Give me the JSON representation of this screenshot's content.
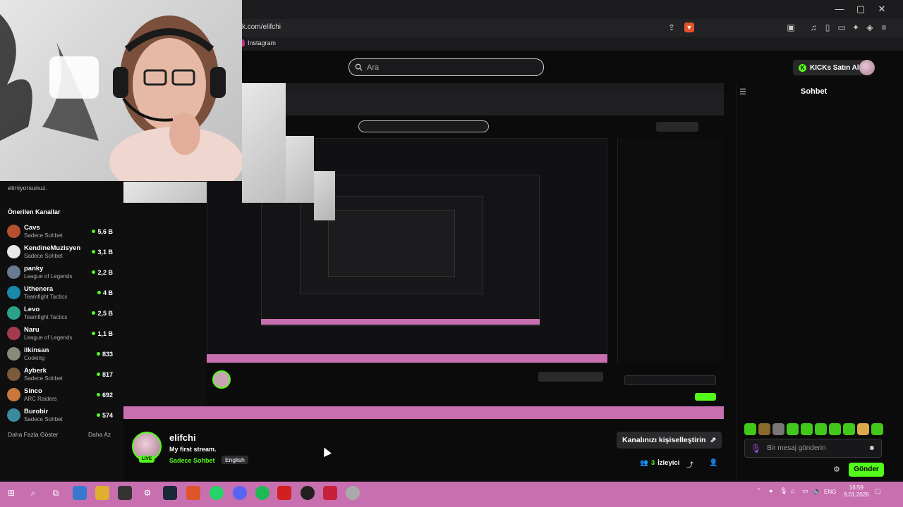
{
  "browser": {
    "url": "k.com/elifchi",
    "bookmark": "Instagram",
    "window_controls": [
      "—",
      "▢",
      "✕"
    ]
  },
  "header": {
    "search_placeholder": "Ara",
    "kicks_button": "KICKs Satın Al"
  },
  "sidebar": {
    "notice": "etmiyorsunuz.",
    "heading": "Önerilen Kanallar",
    "channels": [
      {
        "name": "Cavs",
        "category": "Sadece Sohbet",
        "viewers": "5,6 B",
        "color": "#b5502f"
      },
      {
        "name": "KendineMuzisyen",
        "category": "Sadece Sohbet",
        "viewers": "3,1 B",
        "color": "#e9e9e9"
      },
      {
        "name": "panky",
        "category": "League of Legends",
        "viewers": "2,2 B",
        "color": "#6a7a90"
      },
      {
        "name": "Uthenera",
        "category": "Teamfight Tactics",
        "viewers": "4 B",
        "color": "#1b88a8"
      },
      {
        "name": "Levo",
        "category": "Teamfight Tactics",
        "viewers": "2,5 B",
        "color": "#2aa38a"
      },
      {
        "name": "Naru",
        "category": "League of Legends",
        "viewers": "1,1 B",
        "color": "#a33a4f"
      },
      {
        "name": "ilkinsan",
        "category": "Cooking",
        "viewers": "833",
        "color": "#8a8a7a"
      },
      {
        "name": "Ayberk",
        "category": "Sadece Sohbet",
        "viewers": "817",
        "color": "#7a5a3a"
      },
      {
        "name": "Sinco",
        "category": "ARC Raiders",
        "viewers": "692",
        "color": "#c8783a"
      },
      {
        "name": "Burobir",
        "category": "Sadece Sohbet",
        "viewers": "574",
        "color": "#3a8aa0"
      }
    ],
    "show_more": "Daha Fazla Göster",
    "show_less": "Daha Az"
  },
  "stream": {
    "streamer": "elifchi",
    "title": "My first stream.",
    "category": "Sadece Sohbet",
    "tag": "English",
    "live_label": "LIVE",
    "customize_button": "Kanalınızı kişiselleştirin",
    "viewer_count": "3",
    "viewer_label": "İzleyici"
  },
  "chat": {
    "title": "Sohbet",
    "input_placeholder": "Bir mesaj gönderin",
    "send_button": "Gönder"
  },
  "taskbar": {
    "language": "ENG",
    "time": "16:59",
    "date": "9.01.2026"
  },
  "colors": {
    "accent": "#53fc18",
    "taskbar": "#c86fb0",
    "background": "#0b0b0c"
  }
}
